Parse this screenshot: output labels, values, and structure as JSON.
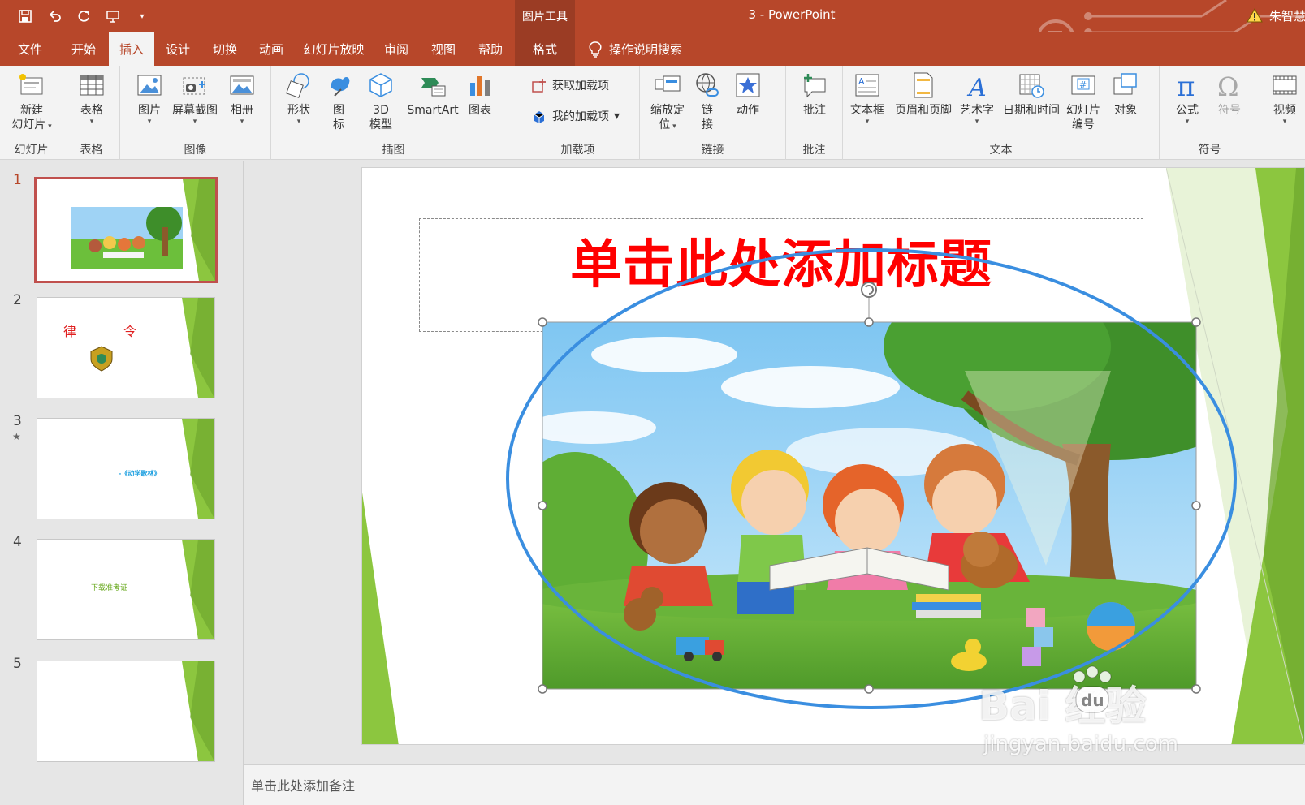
{
  "app": {
    "window_title": "3 - PowerPoint",
    "context_tool_label": "图片工具",
    "user_name": "朱智慧"
  },
  "tabs": [
    {
      "label": "文件"
    },
    {
      "label": "开始"
    },
    {
      "label": "插入",
      "active": true
    },
    {
      "label": "设计"
    },
    {
      "label": "切换"
    },
    {
      "label": "动画"
    },
    {
      "label": "幻灯片放映"
    },
    {
      "label": "审阅"
    },
    {
      "label": "视图"
    },
    {
      "label": "帮助"
    },
    {
      "label": "格式",
      "context": true
    }
  ],
  "search_label": "操作说明搜索",
  "ribbon": {
    "groups": {
      "slides": "幻灯片",
      "tables": "表格",
      "images": "图像",
      "illustrations": "插图",
      "addins": "加载项",
      "links": "链接",
      "comments": "批注",
      "text": "文本",
      "symbols": "符号"
    },
    "buttons": {
      "new_slide_1": "新建",
      "new_slide_2": "幻灯片",
      "table": "表格",
      "pictures": "图片",
      "screenshot": "屏幕截图",
      "album": "相册",
      "shapes": "形状",
      "icons_1": "图",
      "icons_2": "标",
      "model3d_1": "3D",
      "model3d_2": "模型",
      "smartart": "SmartArt",
      "chart": "图表",
      "get_addins": "获取加载项",
      "my_addins": "我的加载项",
      "zoom_1": "缩放定",
      "zoom_2": "位",
      "link_1": "链",
      "link_2": "接",
      "action": "动作",
      "comment": "批注",
      "textbox": "文本框",
      "header_footer": "页眉和页脚",
      "wordart": "艺术字",
      "date_time": "日期和时间",
      "slide_number_1": "幻灯片",
      "slide_number_2": "编号",
      "object": "对象",
      "equation": "公式",
      "symbol": "符号",
      "video": "视频"
    }
  },
  "thumbnails": [
    {
      "number": "1",
      "active": true,
      "text": ""
    },
    {
      "number": "2",
      "text_left": "律",
      "text_right": "令"
    },
    {
      "number": "3",
      "star": "★",
      "text": "-《动学歌林》"
    },
    {
      "number": "4",
      "text": "下载准考证"
    },
    {
      "number": "5",
      "text": ""
    }
  ],
  "slide": {
    "title": "单击此处添加标题"
  },
  "notes_placeholder": "单击此处添加备注",
  "watermark": {
    "brand": "Bai  经验",
    "url": "jingyan.baidu.com"
  },
  "colors": {
    "accent": "#b7472a",
    "accent_dark": "#9b3c24",
    "title_red": "#ff0000",
    "theme_green": "#8cc63f",
    "ellipse_blue": "#3a8ee0"
  }
}
